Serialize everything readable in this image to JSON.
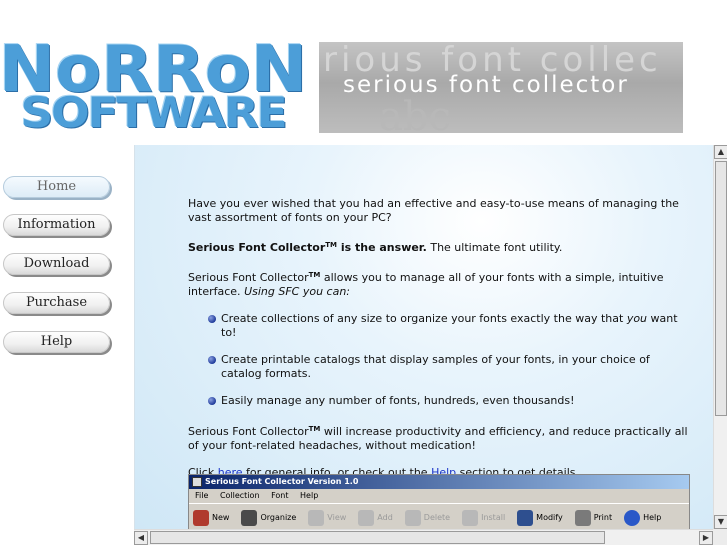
{
  "header": {
    "logo_line1": "NoRRoN",
    "logo_line2": "SOFTWARE",
    "banner_ghost_text": "rious font collec",
    "banner_tagline": "serious font collector"
  },
  "nav": {
    "items": [
      {
        "label": "Home",
        "active": true
      },
      {
        "label": "Information",
        "active": false
      },
      {
        "label": "Download",
        "active": false
      },
      {
        "label": "Purchase",
        "active": false
      },
      {
        "label": "Help",
        "active": false
      }
    ]
  },
  "content": {
    "intro": "Have you ever wished that you had an effective and easy-to-use means of managing the vast assortment of fonts on your PC?",
    "answer_bold": "Serious Font Collector",
    "answer_bold_sup": "TM",
    "answer_bold_tail": " is the answer.",
    "answer_rest": " The ultimate font utility.",
    "p2_name": "Serious Font Collector",
    "p2_sup": "TM",
    "p2_text": " allows you to manage all of your fonts with a simple, intuitive interface. ",
    "p2_italic": "Using SFC you can:",
    "bullets": {
      "b1_pre": "Create collections of any size to organize your fonts exactly the way that ",
      "b1_em": "you",
      "b1_post": " want to!",
      "b2": "Create printable catalogs that display samples of your fonts, in your choice of catalog formats.",
      "b3": "Easily manage any number of fonts, hundreds, even thousands!"
    },
    "p3_name": "Serious Font Collector",
    "p3_sup": "TM",
    "p3_text": " will increase productivity and efficiency, and reduce practically all of your font-related headaches, without medication!",
    "p4_pre": "Click ",
    "p4_link1": "here",
    "p4_mid": " for general info, or check out the ",
    "p4_link2": "Help",
    "p4_post": " section to get details."
  },
  "app_screenshot": {
    "title": "Serious Font Collector Version 1.0",
    "menu": [
      "File",
      "Collection",
      "Font",
      "Help"
    ],
    "toolbar": [
      {
        "label": "New",
        "icon": "book-icon",
        "enabled": true
      },
      {
        "label": "Organize",
        "icon": "organize-icon",
        "enabled": true
      },
      {
        "label": "View",
        "icon": "view-icon",
        "enabled": false
      },
      {
        "label": "Add",
        "icon": "add-icon",
        "enabled": false
      },
      {
        "label": "Delete",
        "icon": "delete-icon",
        "enabled": false
      },
      {
        "label": "Install",
        "icon": "install-icon",
        "enabled": false
      },
      {
        "label": "Modify",
        "icon": "modify-icon",
        "enabled": true
      },
      {
        "label": "Print",
        "icon": "printer-icon",
        "enabled": true
      },
      {
        "label": "Help",
        "icon": "help-icon",
        "enabled": true
      }
    ]
  },
  "colors": {
    "logo_blue": "#4c9ed8",
    "link_blue": "#1a33c8",
    "bullet_blue": "#1e3a9a",
    "content_bg": "#cfe7f6"
  }
}
